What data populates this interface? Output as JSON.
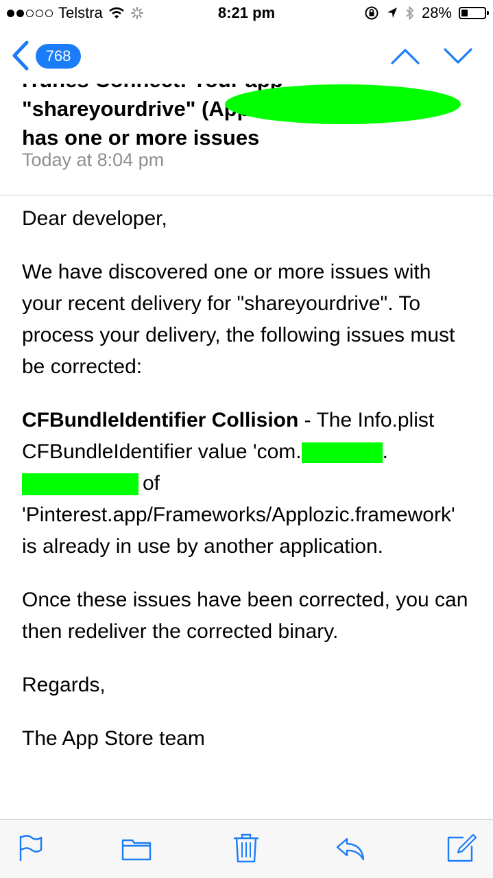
{
  "status_bar": {
    "carrier": "Telstra",
    "time": "8:21 pm",
    "battery_percent": "28%"
  },
  "nav": {
    "message_count": "768"
  },
  "header": {
    "subject_line1": "iTunes Connect: Your app",
    "subject_line2": "\"shareyourdrive\" (App",
    "subject_line3": "has one or more issues",
    "date": "Today at 8:04 pm"
  },
  "body": {
    "greeting": "Dear developer,",
    "intro": "We have discovered one or more issues with your recent delivery for \"shareyourdrive\". To process your delivery, the following issues must be corrected:",
    "issue_title": "CFBundleIdentifier Collision",
    "issue_text_1": " - The Info.plist CFBundleIdentifier value 'com.",
    "issue_text_2": "of 'Pinterest.app/Frameworks/Applozic.framework' is already in use by another application.",
    "outro": "Once these issues have been corrected, you can then redeliver the corrected binary.",
    "regards": "Regards,",
    "signature": "The App Store team"
  },
  "icons": {
    "accent": "#1a7cf7",
    "redaction": "#00ff00"
  }
}
